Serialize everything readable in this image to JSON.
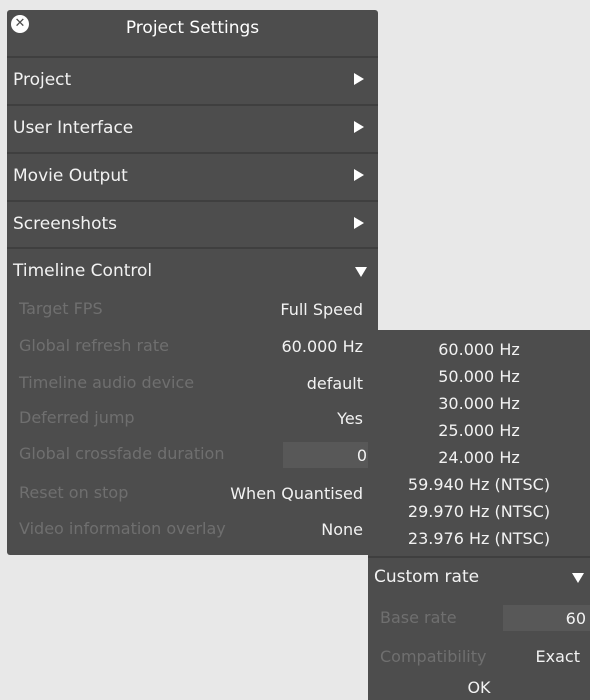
{
  "dialog": {
    "title": "Project Settings"
  },
  "sections": [
    {
      "label": "Project"
    },
    {
      "label": "User Interface"
    },
    {
      "label": "Movie Output"
    },
    {
      "label": "Screenshots"
    },
    {
      "label": "Timeline Control"
    }
  ],
  "timeline": {
    "rows": [
      {
        "label": "Target FPS",
        "value": "Full Speed"
      },
      {
        "label": "Global refresh rate",
        "value": "60.000 Hz"
      },
      {
        "label": "Timeline audio device",
        "value": "default"
      },
      {
        "label": "Deferred jump",
        "value": "Yes"
      },
      {
        "label": "Global crossfade duration",
        "value": "0"
      },
      {
        "label": "Reset on stop",
        "value": "When Quantised"
      },
      {
        "label": "Video information overlay",
        "value": "None"
      }
    ]
  },
  "refresh_dropdown": {
    "options": [
      "60.000 Hz",
      "50.000 Hz",
      "30.000 Hz",
      "25.000 Hz",
      "24.000 Hz",
      "59.940 Hz (NTSC)",
      "29.970 Hz (NTSC)",
      "23.976 Hz (NTSC)"
    ],
    "custom": {
      "label": "Custom rate",
      "base_rate_label": "Base rate",
      "base_rate_value": "60",
      "compat_label": "Compatibility",
      "compat_value": "Exact",
      "ok_label": "OK"
    }
  },
  "colors": {
    "panel": "#4d4d4d",
    "divider": "#3f3f3f",
    "disabled_text": "#6f6f6f",
    "text": "#f2f2f2",
    "field": "#585858"
  }
}
